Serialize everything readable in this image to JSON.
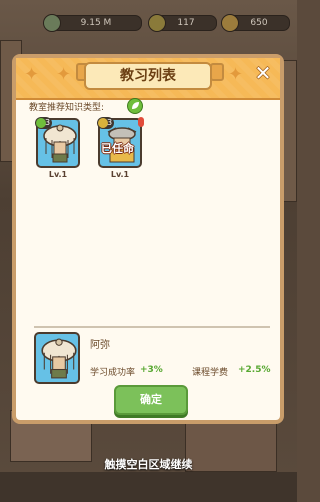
{
  "status_bar": {
    "stat1": "9.15 M",
    "stat2": "117",
    "stat3": "650"
  },
  "modal": {
    "title": "教习列表",
    "close_icon": "close-icon",
    "recommend_label": "教室推荐知识类型:",
    "recommend_icon": "leaf-icon",
    "teachers": [
      {
        "level_badge": "3",
        "level_label": "Lv.1",
        "assigned": ""
      },
      {
        "level_badge": "3",
        "level_label": "Lv.1",
        "assigned": "已任命",
        "tag": ""
      }
    ],
    "selected": {
      "name": "阿弥",
      "success_label": "学习成功率",
      "success_value": "+3%",
      "fee_label": "课程学费",
      "fee_value": "+2.5%"
    },
    "confirm_label": "确定"
  },
  "hint": "触摸空白区域继续",
  "colors": {
    "header": "#f6b957",
    "panel": "#fffaf0",
    "card_bg": "#66c1e6",
    "confirm": "#7cc15a",
    "positive": "#58a832"
  }
}
